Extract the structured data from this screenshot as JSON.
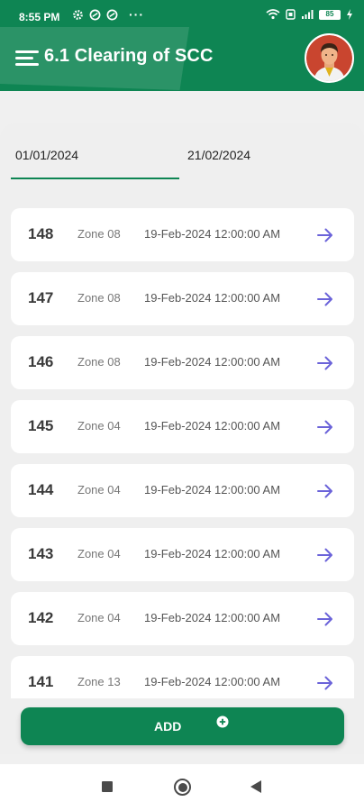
{
  "status_bar": {
    "time": "8:55 PM",
    "battery": "85"
  },
  "header": {
    "title": "6.1 Clearing of SCC"
  },
  "filters": {
    "date_from": "01/01/2024",
    "date_to": "21/02/2024"
  },
  "records": [
    {
      "id": "148",
      "zone": "Zone 08",
      "date": "19-Feb-2024 12:00:00 AM"
    },
    {
      "id": "147",
      "zone": "Zone 08",
      "date": "19-Feb-2024 12:00:00 AM"
    },
    {
      "id": "146",
      "zone": "Zone 08",
      "date": "19-Feb-2024 12:00:00 AM"
    },
    {
      "id": "145",
      "zone": "Zone 04",
      "date": "19-Feb-2024 12:00:00 AM"
    },
    {
      "id": "144",
      "zone": "Zone 04",
      "date": "19-Feb-2024 12:00:00 AM"
    },
    {
      "id": "143",
      "zone": "Zone 04",
      "date": "19-Feb-2024 12:00:00 AM"
    },
    {
      "id": "142",
      "zone": "Zone 04",
      "date": "19-Feb-2024 12:00:00 AM"
    },
    {
      "id": "141",
      "zone": "Zone 13",
      "date": "19-Feb-2024 12:00:00 AM"
    }
  ],
  "actions": {
    "add_label": "ADD"
  },
  "colors": {
    "primary": "#0e8553",
    "arrow": "#6b63d9"
  }
}
